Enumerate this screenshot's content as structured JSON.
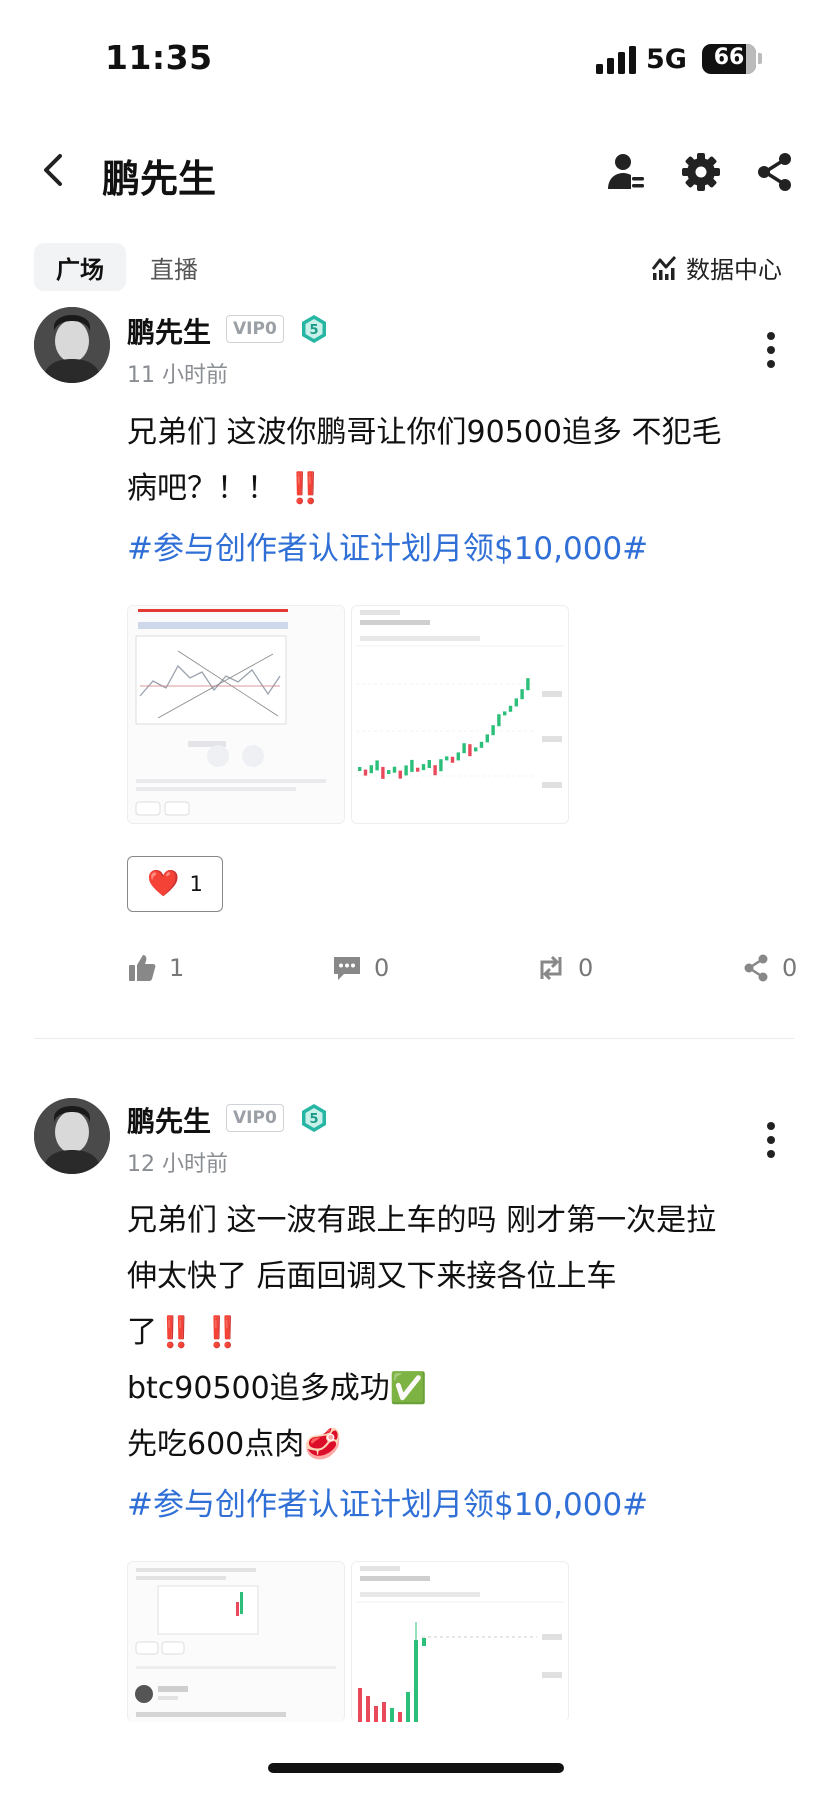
{
  "status": {
    "time": "11:35",
    "network": "5G",
    "battery": "66"
  },
  "header": {
    "title": "鹏先生"
  },
  "tabs": [
    {
      "label": "广场",
      "active": true
    },
    {
      "label": "直播",
      "active": false
    }
  ],
  "data_center": {
    "label": "数据中心"
  },
  "posts": [
    {
      "author": "鹏先生",
      "vip": "VIP0",
      "level": "5",
      "time": "11 小时前",
      "lines": [
        "兄弟们 这波你鹏哥让你们90500追多 不犯毛",
        "病吧？！！ ‼️"
      ],
      "hashtag": "#参与创作者认证计划月领$10,000#",
      "reaction": {
        "emoji": "❤️",
        "count": "1"
      },
      "actions": {
        "likes": "1",
        "comments": "0",
        "reposts": "0",
        "shares": "0"
      }
    },
    {
      "author": "鹏先生",
      "vip": "VIP0",
      "level": "5",
      "time": "12 小时前",
      "lines": [
        "兄弟们 这一波有跟上车的吗 刚才第一次是拉",
        "伸太快了 后面回调又下来接各位上车",
        "了‼️ ‼️",
        "btc90500追多成功✅",
        "先吃600点肉🥩"
      ],
      "hashtag": "#参与创作者认证计划月领$10,000#"
    }
  ],
  "colors": {
    "hashtag": "#2f6fd6",
    "level_badge": "#27b6a4",
    "up_candle": "#2bbf7a",
    "down_candle": "#e94a5b"
  }
}
